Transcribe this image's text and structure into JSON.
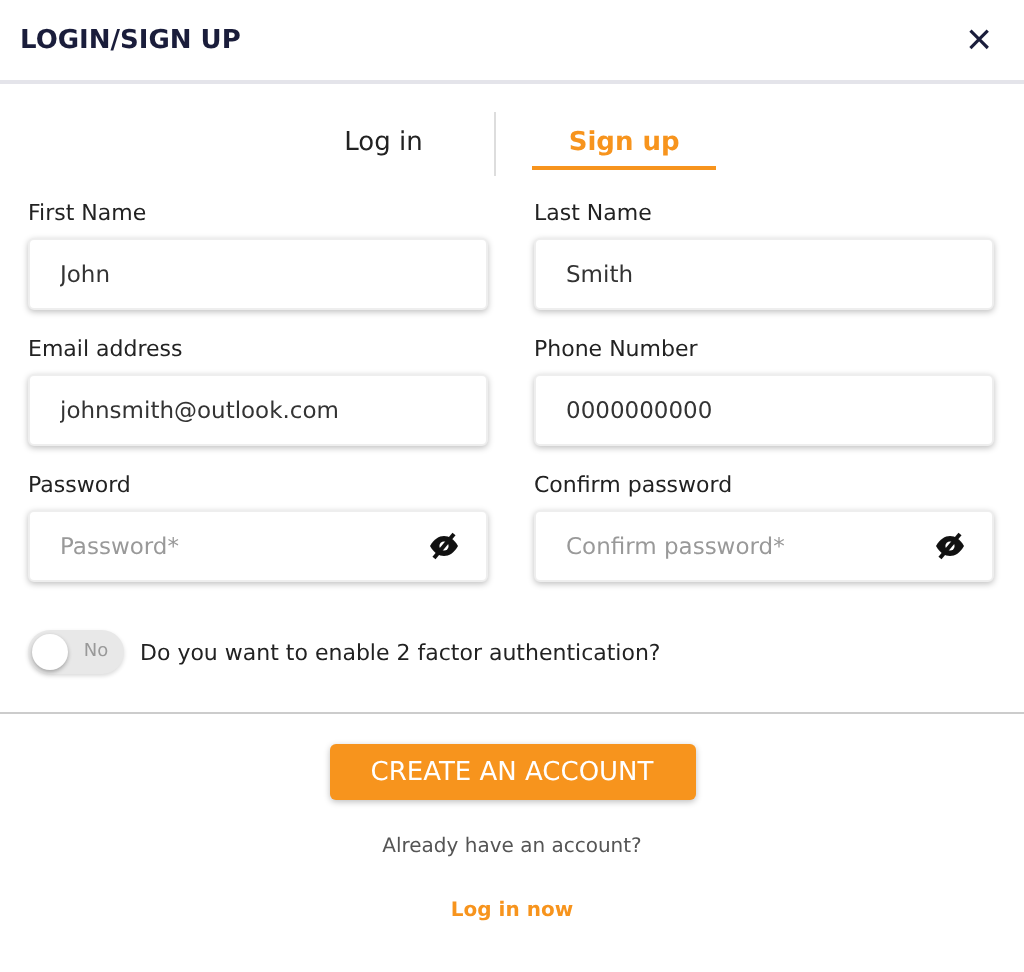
{
  "window": {
    "title": "LOGIN/SIGN UP",
    "close": "×"
  },
  "tabs": [
    {
      "label": "Log in",
      "selected": false
    },
    {
      "label": "Sign up",
      "selected": true
    }
  ],
  "fields": [
    {
      "kind": "text",
      "label": "First Name",
      "value": "John"
    },
    {
      "kind": "text",
      "label": "Last Name",
      "value": "Smith"
    },
    {
      "kind": "text",
      "label": "Email address",
      "value": "johnsmith@outlook.com"
    },
    {
      "kind": "text",
      "label": "Phone Number",
      "value": "0000000000"
    },
    {
      "kind": "password",
      "label": "Password",
      "placeholder": "Password*"
    },
    {
      "kind": "password",
      "label": "Confirm password",
      "placeholder": "Confirm password*"
    }
  ],
  "two_factor": {
    "on": false,
    "toggle_label": "No",
    "question": "Do you want to enable 2 factor authentication?"
  },
  "submit": "CREATE AN ACCOUNT",
  "footer": {
    "prompt": "Already have an account?",
    "link": "Log in now"
  }
}
